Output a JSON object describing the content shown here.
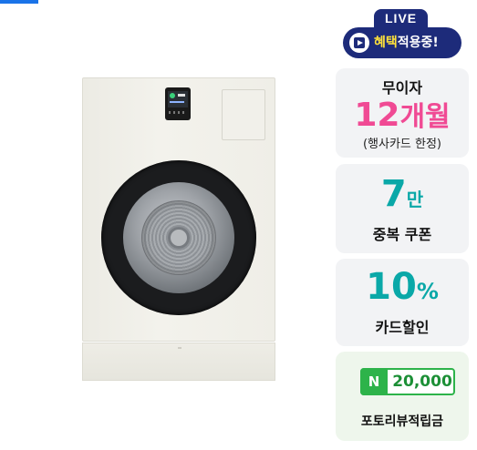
{
  "live_badge": {
    "tag": "LIVE",
    "text_highlight": "혜택",
    "text_rest": "적용중!"
  },
  "cards": {
    "installment": {
      "title": "무이자",
      "months_num": "12",
      "months_unit": "개월",
      "note": "(행사카드 한정)"
    },
    "coupon": {
      "amount": "7",
      "unit": "만",
      "label": "중복 쿠폰"
    },
    "card_discount": {
      "amount": "10",
      "unit": "%",
      "label": "카드할인"
    },
    "naver_points": {
      "logo": "N",
      "amount": "20,000",
      "label": "포토리뷰적립금"
    }
  },
  "colors": {
    "live_navy": "#1d2b7a",
    "pink": "#f04a94",
    "teal": "#0aa8a8",
    "naver_green": "#2db34a"
  }
}
